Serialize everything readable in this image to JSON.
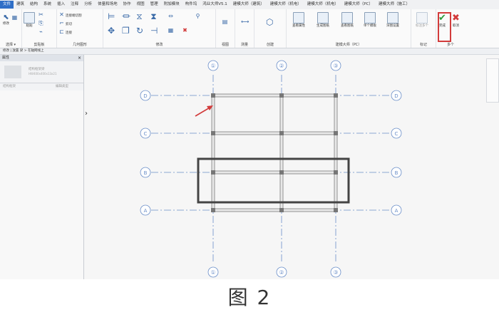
{
  "ribbon": {
    "tabs": [
      "文件",
      "建筑",
      "结构",
      "系统",
      "插入",
      "注释",
      "分析",
      "体量和场地",
      "协作",
      "视图",
      "管理",
      "附加模块",
      "构件坞",
      "鸿业大师V5.1",
      "建模大师（建筑）",
      "建模大师（机电）",
      "建模大师（机电）",
      "建模大师（PC）",
      "建模大师（施工）"
    ],
    "active_tab_index": 0,
    "panels": {
      "select": "选择 ▾",
      "properties": "属性",
      "clipboard": "剪贴板",
      "geometry": "几何图形",
      "modify": "修改",
      "view": "视图",
      "measure": "测量",
      "create": "创建",
      "pc": "建模大师（PC）",
      "mark": "标记",
      "mode": "多个"
    },
    "buttons": {
      "modify": "修改",
      "paste": "粘贴",
      "cut": "剪切",
      "join": "连接",
      "view_props": "查看属性",
      "gen_drawing": "生成图纸",
      "view_drawing": "查看图纸",
      "single_model": "单个模板",
      "settings": "深图设置",
      "smart_tag": "标注多个",
      "finish": "完成",
      "cancel": "取消"
    },
    "small_labels": {
      "cut_geom": "连接端切割",
      "cut2": "剪切",
      "join2": "连接"
    }
  },
  "status_bar": "修改 | 放置 梁 > 在轴网线上",
  "properties": {
    "title": "属性",
    "close": "×",
    "type_name": "结构框架梁",
    "type_sub": "HW400x400x13x21",
    "filter": "结构框架",
    "edit_type": "编辑类型"
  },
  "grid": {
    "vertical_labels": [
      "①",
      "②",
      "③"
    ],
    "horizontal_labels": [
      "D",
      "C",
      "B",
      "A"
    ]
  },
  "colors": {
    "accent": "#2f6fc7",
    "highlight": "#d23b3b",
    "grid": "#6a8ec8",
    "beam": "#555555"
  },
  "caption": "图 2"
}
